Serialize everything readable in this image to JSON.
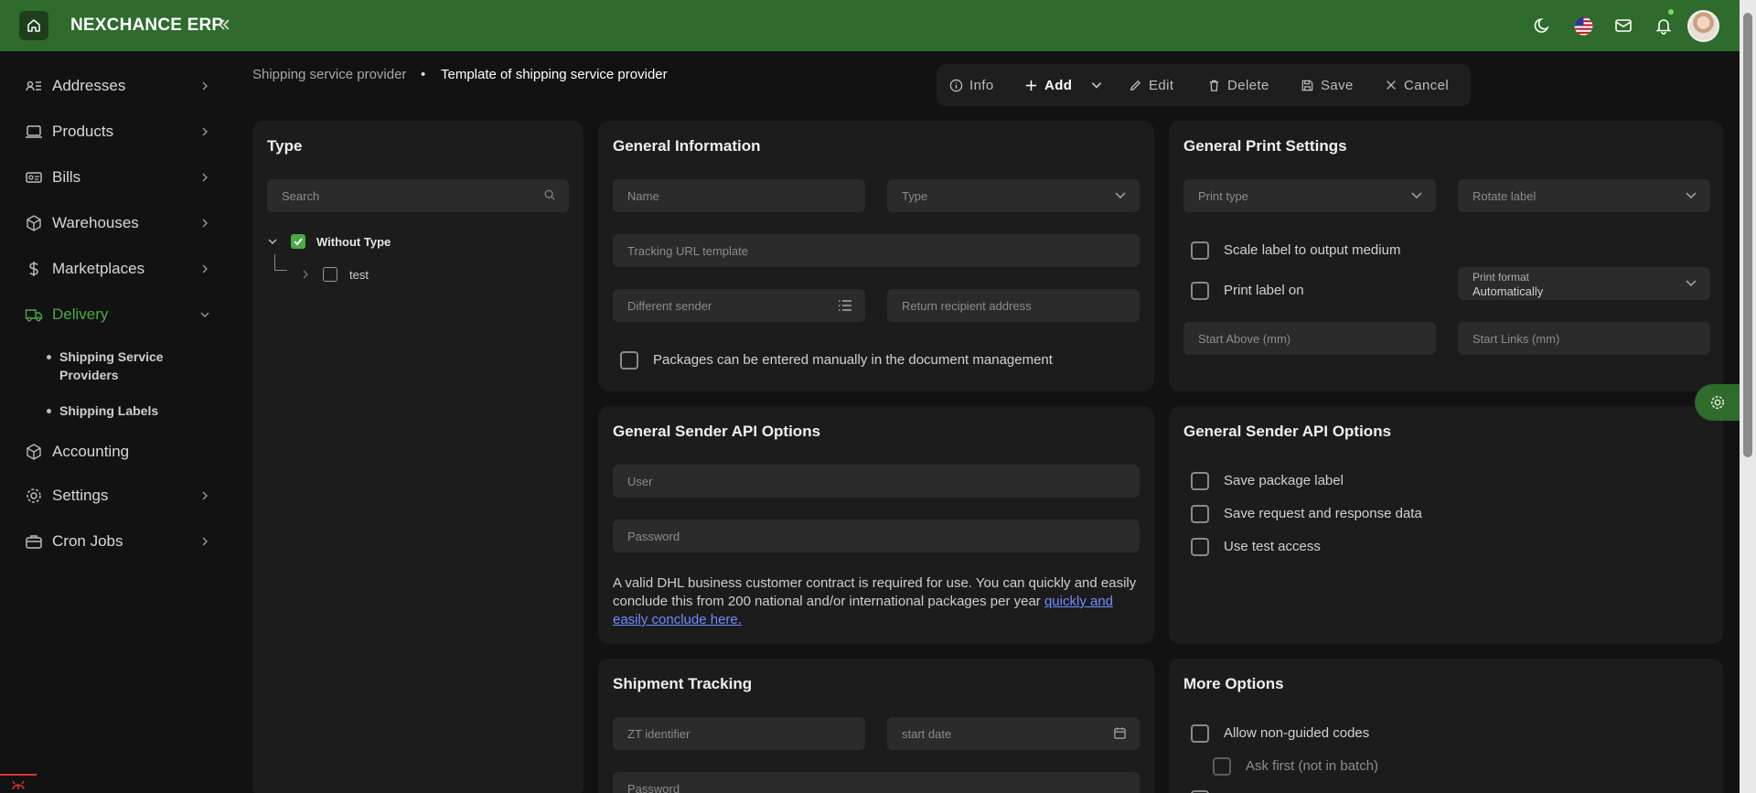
{
  "app": {
    "title": "NEXCHANCE ERP"
  },
  "colors": {
    "brand": "#2e6b2c",
    "accent_green": "#4caa44",
    "link": "#6f8cff",
    "background": "#121212",
    "card": "#1c1c1c"
  },
  "topbar": {
    "icons": [
      "home-icon",
      "double-chevron-left-icon",
      "moon-icon",
      "us-flag-icon",
      "mail-icon",
      "bell-icon",
      "avatar"
    ]
  },
  "sidebar": {
    "items": [
      {
        "label": "Addresses",
        "icon": "address-book-icon"
      },
      {
        "label": "Products",
        "icon": "laptop-icon"
      },
      {
        "label": "Bills",
        "icon": "bill-icon"
      },
      {
        "label": "Warehouses",
        "icon": "box-icon"
      },
      {
        "label": "Marketplaces",
        "icon": "dollar-icon"
      },
      {
        "label": "Delivery",
        "icon": "truck-icon"
      },
      {
        "label": "Accounting",
        "icon": "box-icon"
      },
      {
        "label": "Settings",
        "icon": "gear-icon"
      },
      {
        "label": "Cron Jobs",
        "icon": "briefcase-icon"
      }
    ],
    "delivery_sub": [
      {
        "label": "Shipping Service Providers"
      },
      {
        "label": "Shipping Labels"
      }
    ]
  },
  "breadcrumb": {
    "parent": "Shipping service provider",
    "separator": "•",
    "current": "Template of shipping service provider"
  },
  "toolbar": {
    "info": "Info",
    "add": "Add",
    "edit": "Edit",
    "delete": "Delete",
    "save": "Save",
    "cancel": "Cancel"
  },
  "type_panel": {
    "title": "Type",
    "search_placeholder": "Search",
    "tree": [
      {
        "label": "Without Type",
        "checked": true,
        "expanded": true
      },
      {
        "label": "test",
        "checked": false,
        "expanded": false
      }
    ]
  },
  "general_info": {
    "title": "General Information",
    "name_placeholder": "Name",
    "type_placeholder": "Type",
    "tracking_placeholder": "Tracking URL template",
    "sender_placeholder": "Different sender",
    "return_placeholder": "Return recipient address",
    "manual_label": "Packages can be entered manually in the document management"
  },
  "print_settings": {
    "title": "General Print Settings",
    "print_type_placeholder": "Print type",
    "rotate_placeholder": "Rotate label",
    "scale_label": "Scale label to output medium",
    "print_on_label": "Print label on",
    "print_format_label": "Print format",
    "print_format_value": "Automatically",
    "start_above_placeholder": "Start Above (mm)",
    "start_links_placeholder": "Start Links (mm)"
  },
  "sender_api": {
    "title": "General Sender API Options",
    "user_placeholder": "User",
    "password_placeholder": "Password",
    "info_text": "A valid DHL business customer contract is required for use. You can quickly and easily conclude this from 200 national and/or international packages per year ",
    "info_link": "quickly and easily conclude here."
  },
  "sender_api_right": {
    "title": "General Sender API Options",
    "opt1": "Save package label",
    "opt2": "Save request and response data",
    "opt3": "Use test access"
  },
  "tracking": {
    "title": "Shipment Tracking",
    "zt_placeholder": "ZT identifier",
    "date_placeholder": "start date",
    "password_placeholder": "Password"
  },
  "more_options": {
    "title": "More Options",
    "opt1": "Allow non-guided codes",
    "opt2": "Ask first (not in batch)"
  }
}
